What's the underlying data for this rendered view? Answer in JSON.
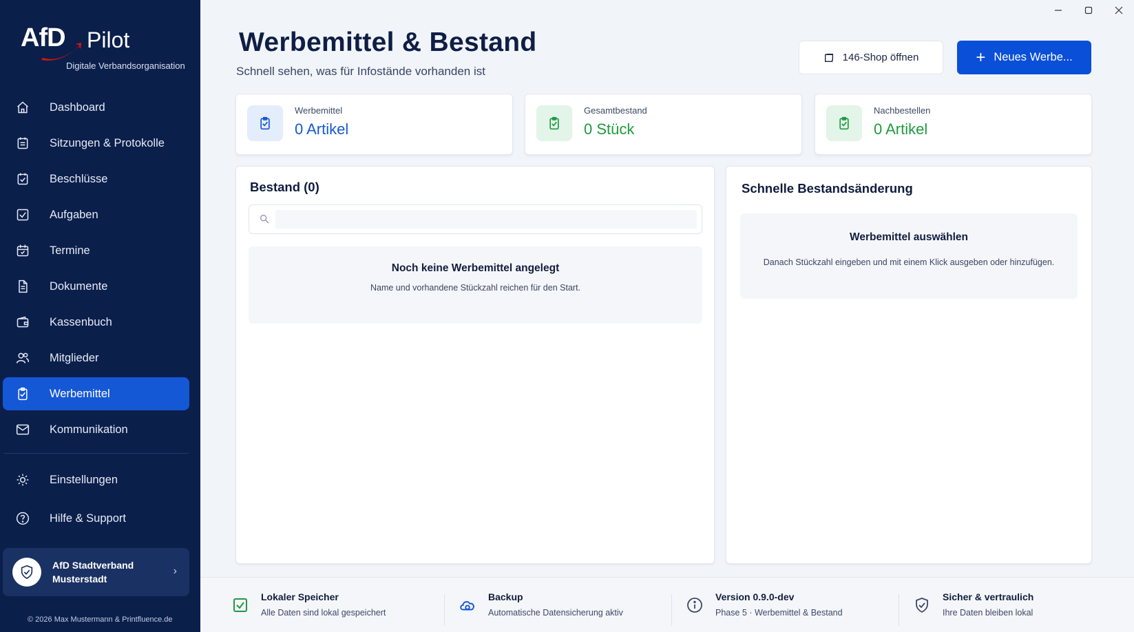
{
  "brand": {
    "logo_text": "AfD",
    "product": "Pilot",
    "subtitle": "Digitale Verbandsorganisation"
  },
  "sidebar": {
    "items": [
      {
        "label": "Dashboard",
        "icon": "home-icon"
      },
      {
        "label": "Sitzungen & Protokolle",
        "icon": "calendar-list-icon"
      },
      {
        "label": "Beschlüsse",
        "icon": "check-document-icon"
      },
      {
        "label": "Aufgaben",
        "icon": "checkbox-icon"
      },
      {
        "label": "Termine",
        "icon": "calendar-check-icon"
      },
      {
        "label": "Dokumente",
        "icon": "document-icon"
      },
      {
        "label": "Kassenbuch",
        "icon": "wallet-icon"
      },
      {
        "label": "Mitglieder",
        "icon": "users-icon"
      },
      {
        "label": "Werbemittel",
        "icon": "clipboard-check-icon",
        "active": true
      },
      {
        "label": "Kommunikation",
        "icon": "mail-icon"
      }
    ],
    "secondary": [
      {
        "label": "Einstellungen",
        "icon": "gear-icon"
      },
      {
        "label": "Hilfe & Support",
        "icon": "help-icon"
      }
    ],
    "org": {
      "name_line1": "AfD Stadtverband",
      "name_line2": "Musterstadt"
    },
    "copyright": "© 2026 Max Mustermann & Printfluence.de"
  },
  "header": {
    "title": "Werbemittel & Bestand",
    "subtitle": "Schnell sehen, was für Infostände vorhanden ist",
    "shop_button": "146-Shop öffnen",
    "new_button": "Neues Werbe..."
  },
  "stats": [
    {
      "label": "Werbemittel",
      "value": "0 Artikel",
      "color": "#1558d6",
      "bg": "#e4edfc"
    },
    {
      "label": "Gesamtbestand",
      "value": "0 Stück",
      "color": "#1f9a3f",
      "bg": "#e3f4e8"
    },
    {
      "label": "Nachbestellen",
      "value": "0 Artikel",
      "color": "#1f9a3f",
      "bg": "#e3f4e8"
    }
  ],
  "bestand": {
    "title": "Bestand (0)",
    "search_placeholder": "",
    "empty_title": "Noch keine Werbemittel angelegt",
    "empty_desc": "Name und vorhandene Stückzahl reichen für den Start."
  },
  "quick": {
    "title": "Schnelle Bestandsänderung",
    "empty_title": "Werbemittel auswählen",
    "empty_desc": "Danach Stückzahl eingeben und mit einem Klick ausgeben oder hinzufügen."
  },
  "footer": [
    {
      "title": "Lokaler Speicher",
      "desc": "Alle Daten sind lokal gespeichert",
      "icon": "check-square-icon"
    },
    {
      "title": "Backup",
      "desc": "Automatische Datensicherung aktiv",
      "icon": "cloud-sync-icon"
    },
    {
      "title": "Version 0.9.0-dev",
      "desc": "Phase 5 · Werbemittel & Bestand",
      "icon": "info-icon"
    },
    {
      "title": "Sicher & vertraulich",
      "desc": "Ihre Daten bleiben lokal",
      "icon": "shield-icon"
    }
  ],
  "colors": {
    "sidebar_bg": "#0b1f4b",
    "accent": "#0a4fd8",
    "success": "#1f9a3f"
  }
}
